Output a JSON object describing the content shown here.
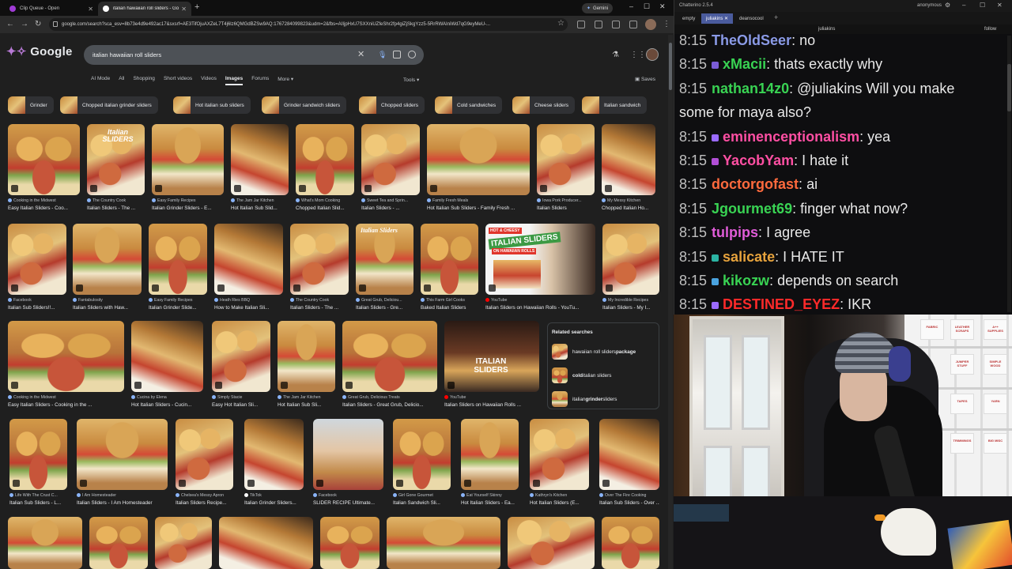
{
  "browser": {
    "tabs": [
      {
        "label": "Clip Queue - Open",
        "fav_color": "#a03bd6"
      },
      {
        "label": "italian hawaiian roll sliders - Go",
        "fav_color": "#ffffff"
      }
    ],
    "gemini_label": "Gemini",
    "url": "google.com/search?sca_esv=8b73e4d9e492ac17&sxsrf=AE3TifOjuAXZeL7T4j6lz6QMGdBZSw9AQ:1767284099823&udm=2&fbs=AIIjpHxU7SXXniUZfeShr2fp4giZjSkgYzz5-5RrRWAIniWd7qG9eyMeU-..."
  },
  "google": {
    "query": "italian hawaiian roll sliders",
    "tabs": [
      "AI Mode",
      "All",
      "Shopping",
      "Short videos",
      "Videos",
      "Images",
      "Forums",
      "More"
    ],
    "active_tab": "Images",
    "tools_label": "Tools",
    "saves_label": "Saves",
    "chips": [
      "Grinder",
      "Chopped italian grinder sliders",
      "Hot italian sub sliders",
      "Grinder sandwich sliders",
      "Chopped sliders",
      "Cold sandwiches",
      "Cheese sliders",
      "Italian sandwich"
    ],
    "rows": [
      [
        {
          "src": "Cooking in the Midwest",
          "title": "Easy Italian Sliders - Coo..."
        },
        {
          "src": "The Country Cook",
          "title": "Italian Sliders - The ..."
        },
        {
          "src": "Easy Family Recipes",
          "title": "Italian Grinder Sliders - E..."
        },
        {
          "src": "The Jam Jar Kitchen",
          "title": "Hot Italian Sub Slid..."
        },
        {
          "src": "What's Mom Cooking",
          "title": "Chopped Italian Slid..."
        },
        {
          "src": "Sweet Tea and Sprin...",
          "title": "Italian Sliders - ..."
        },
        {
          "src": "Family Fresh Meals",
          "title": "Hot Italian Sub Sliders - Family Fresh ..."
        },
        {
          "src": "Iowa Pork Producer...",
          "title": "Italian Sliders"
        },
        {
          "src": "My Messy Kitchen",
          "title": "Chopped Italian Ho..."
        }
      ],
      [
        {
          "src": "Facebook",
          "title": "Italian Sub Sliders!!..."
        },
        {
          "src": "Fantabulosity",
          "title": "Italian Sliders with Haw..."
        },
        {
          "src": "Easy Family Recipes",
          "title": "Italian Grinder Slide..."
        },
        {
          "src": "Heath Ries BBQ",
          "title": "How to Make Italian Sli..."
        },
        {
          "src": "The Country Cook",
          "title": "Italian Sliders - The ..."
        },
        {
          "src": "Great Grub, Deliciou...",
          "title": "Italian Sliders - Gre..."
        },
        {
          "src": "This Farm Girl Cooks",
          "title": "Baked Italian Sliders"
        },
        {
          "src": "YouTube",
          "title": "Italian Sliders on Hawaiian Rolls - YouTu..."
        },
        {
          "src": "My Incredible Recipes",
          "title": "Italian Sliders - My I..."
        }
      ],
      [
        {
          "src": "Cooking in the Midwest",
          "title": "Easy Italian Sliders - Cooking in the ..."
        },
        {
          "src": "Cucina by Elena",
          "title": "Hot Italian Sliders - Cucin..."
        },
        {
          "src": "Simply Stacie",
          "title": "Easy Hot Italian Sli..."
        },
        {
          "src": "The Jam Jar Kitchen",
          "title": "Hot Italian Sub Sli..."
        },
        {
          "src": "Great Grub, Delicious Treats",
          "title": "Italian Sliders - Great Grub, Delicio..."
        },
        {
          "src": "YouTube",
          "title": "Italian Sliders on Hawaiian Rolls ..."
        }
      ],
      [
        {
          "src": "Life With The Crust C...",
          "title": "Italian Sub Sliders - L..."
        },
        {
          "src": "I Am Homesteader",
          "title": "Italian Sliders - I Am Homesteader"
        },
        {
          "src": "Chelsea's Messy Apron",
          "title": "Italian Sliders Recipe..."
        },
        {
          "src": "TikTok",
          "title": "Italian Grinder Sliders..."
        },
        {
          "src": "Facebook",
          "title": "SLIDER RECIPE Ultimate..."
        },
        {
          "src": "Girl Gone Gourmet",
          "title": "Italian Sandwich Sli..."
        },
        {
          "src": "Eat Yourself Skinny",
          "title": "Hot Italian Sliders - Ea..."
        },
        {
          "src": "Kathryn's Kitchen",
          "title": "Hot Italian Sliders (E..."
        },
        {
          "src": "Over The Fire Cooking",
          "title": "Italian Sub Sliders - Over ..."
        }
      ]
    ],
    "image_overlays": {
      "italian_sliders_1": "Italian SLIDERS",
      "italian_sliders_2": "Italian Sliders",
      "hot_cheesy": "HOT & CHEESY",
      "italian_sliders_banner": "ITALIAN SLIDERS",
      "on_hawaiian": "ON HAWAIIAN ROLLS",
      "italian_sliders_yt": "ITALIAN SLIDERS"
    },
    "related": {
      "heading": "Related searches",
      "items": [
        {
          "pre": "hawaiian roll sliders ",
          "bold": "package"
        },
        {
          "pre": "",
          "bold": "cold",
          "post": " italian sliders"
        },
        {
          "pre": "italian ",
          "bold": "grinder",
          "post": " sliders"
        }
      ]
    }
  },
  "chatterino": {
    "title": "Chatterino 2.5.4",
    "account": "anonymous",
    "tabs": [
      "empty",
      "juliakins",
      "deansocool"
    ],
    "active_tab": "juliakins",
    "channel": "juliakins",
    "follow_label": "follow",
    "messages": [
      {
        "time": "8:15",
        "user": "TheOldSeer",
        "text": "no",
        "color": "#8a9ae6",
        "badge": ""
      },
      {
        "time": "8:15",
        "user": "xMacii",
        "text": "thats exactly why",
        "color": "#39d353",
        "badge": "#7b5cd6"
      },
      {
        "time": "8:15",
        "user": "nathan14z0",
        "text": "@juliakins Will you make",
        "color": "#39d353",
        "badge": ""
      },
      {
        "time": "",
        "user": "",
        "text": "some for maya also?",
        "color": "#39d353",
        "badge": ""
      },
      {
        "time": "8:15",
        "user": "eminenceptionalism",
        "text": "yea",
        "color": "#ff4fa3",
        "badge": "#9b6bff"
      },
      {
        "time": "8:15",
        "user": "YacobYam",
        "text": "I hate it",
        "color": "#ff4fa3",
        "badge": "#b24fd6"
      },
      {
        "time": "8:15",
        "user": "doctorgofast",
        "text": "ai",
        "color": "#ff6a3d",
        "badge": ""
      },
      {
        "time": "8:15",
        "user": "Jgourmet69",
        "text": "finger what now?",
        "color": "#39d353",
        "badge": ""
      },
      {
        "time": "8:15",
        "user": "tulpips",
        "text": "I agree",
        "color": "#e05cd8",
        "badge": ""
      },
      {
        "time": "8:15",
        "user": "salicate",
        "text": "I HATE IT",
        "color": "#e6a23c",
        "badge": "#2bb3a3"
      },
      {
        "time": "8:15",
        "user": "kikozw",
        "text": "depends on search",
        "color": "#39d353",
        "badge": "#4aa3df"
      },
      {
        "time": "8:15",
        "user": "DESTINED_EYEZ",
        "text": "IKR",
        "color": "#ff2a2a",
        "badge": "#9b6bff"
      }
    ]
  },
  "webcam": {
    "box_labels": [
      "LEATHER SCRAPS",
      "A++ SUPPLIES",
      "FABRIC",
      "JUMPER STUFF",
      "SIMPLE WOOD",
      "TAPES",
      "YARN",
      "TRIMMINGS",
      "BIG MISC"
    ]
  }
}
